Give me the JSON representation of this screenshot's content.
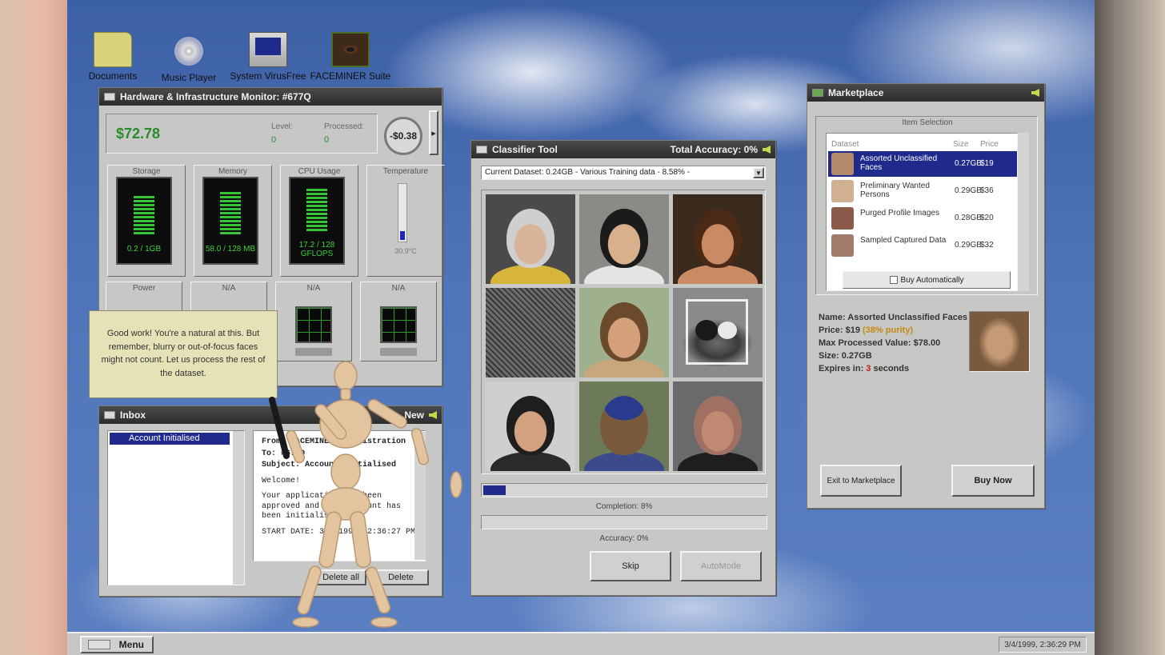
{
  "desktop": {
    "icons": [
      {
        "label": "Documents",
        "icon": "folder-icon"
      },
      {
        "label": "Music Player",
        "icon": "cd-icon"
      },
      {
        "label": "System VirusFree",
        "icon": "monitor-icon"
      },
      {
        "label": "FACEMINER Suite",
        "icon": "eye-icon"
      }
    ]
  },
  "hw": {
    "title": "Hardware & Infrastructure Monitor: #677Q",
    "money": "$72.78",
    "level_label": "Level:",
    "level": "0",
    "processed_label": "Processed:",
    "processed": "0",
    "delta": "-$0.38",
    "gauges": [
      {
        "label": "Storage",
        "value": "0.2 / 1GB",
        "level": 0.85
      },
      {
        "label": "Memory",
        "value": "58.0 / 128 MB",
        "level": 0.9
      },
      {
        "label": "CPU Usage",
        "value": "17.2 / 128 GFLOPS",
        "level": 0.88
      },
      {
        "label": "Temperature",
        "value": "30.9°C",
        "level": 0.16
      }
    ],
    "slots": [
      "Power",
      "N/A",
      "N/A",
      "N/A"
    ]
  },
  "tooltip": {
    "text": "Good work! You're a natural at this. But remember, blurry or out-of-focus faces might not count. Let us process the rest of the dataset."
  },
  "inbox": {
    "title": "Inbox",
    "new_label": "New",
    "selected_item": "Account Initialised",
    "from": "From: FACEMINER Administration",
    "to": "To: #677Q",
    "subject": "Subject: Account Initialised",
    "greeting": "Welcome!",
    "body": "Your application has been approved and your account has been initialised.",
    "start": "START DATE: 3/4/1999, 2:36:27 PM",
    "delete_all_label": "Delete all",
    "delete_label": "Delete"
  },
  "classifier": {
    "title": "Classifier Tool",
    "accuracy_header": "Total Accuracy: 0%",
    "dataset": "Current Dataset: 0.24GB - Various Training data - 8.58% -",
    "completion": 0.08,
    "completion_label": "Completion: 8%",
    "accuracy": 0,
    "accuracy_label": "Accuracy: 0%",
    "skip_label": "Skip",
    "automode_label": "AutoMode",
    "images": [
      {
        "kind": "face",
        "skin": "#d8b49a",
        "hair": "#cfcfcf",
        "bg": "#4a4a4a",
        "cloth": "#d7b43a"
      },
      {
        "kind": "face",
        "skin": "#d9b08c",
        "hair": "#1b1b1b",
        "bg": "#8c8a86",
        "cloth": "#e4e4e4"
      },
      {
        "kind": "face",
        "skin": "#c98a64",
        "hair": "#4a2a16",
        "bg": "#3a2a1e",
        "cloth": "#c98a64"
      },
      {
        "kind": "noise"
      },
      {
        "kind": "face",
        "skin": "#d4a07a",
        "hair": "#6a4a2a",
        "bg": "#9fb08e",
        "cloth": "#c9a77c"
      },
      {
        "kind": "cat"
      },
      {
        "kind": "face",
        "skin": "#d3a17f",
        "hair": "#1e1e1e",
        "bg": "#cfcfcf",
        "cloth": "#2a2a2a"
      },
      {
        "kind": "back",
        "skin": "#7a5a3c",
        "hair": "#2a3a8c",
        "bg": "#6d7a5a",
        "cloth": "#3a4a8a"
      },
      {
        "kind": "face",
        "skin": "#c08a72",
        "hair": "#a07062",
        "bg": "#6a6a6a",
        "cloth": "#1e1e1e"
      }
    ]
  },
  "marketplace": {
    "title": "Marketplace",
    "group_label": "Item Selection",
    "col_dataset": "Dataset",
    "col_size": "Size",
    "col_price": "Price",
    "rows": [
      {
        "name": "Assorted Unclassified Faces",
        "size": "0.27GB",
        "price": "$19"
      },
      {
        "name": "Preliminary Wanted Persons",
        "size": "0.29GB",
        "price": "$36"
      },
      {
        "name": "Purged Profile Images",
        "size": "0.28GB",
        "price": "$20"
      },
      {
        "name": "Sampled Captured Data",
        "size": "0.29GB",
        "price": "$32"
      }
    ],
    "buy_auto_label": "Buy Automatically",
    "detail_name": "Name: Assorted Unclassified Faces",
    "detail_price_prefix": "Price: $19 ",
    "detail_purity": "(38% purity)",
    "detail_max": "Max Processed Value: $78.00",
    "detail_size": "Size: 0.27GB",
    "detail_expires_prefix": "Expires in: ",
    "detail_expires_value": "3",
    "detail_expires_suffix": " seconds",
    "exit_label": "Exit to Marketplace",
    "buy_label": "Buy Now"
  },
  "taskbar": {
    "menu_label": "Menu",
    "clock": "3/4/1999, 2:36:29 PM"
  },
  "colors": {
    "selection": "#1f2a8c",
    "money": "#2b8a2b",
    "gauge": "#35c435",
    "purity": "#c48a12",
    "expires": "#c21d1d"
  }
}
